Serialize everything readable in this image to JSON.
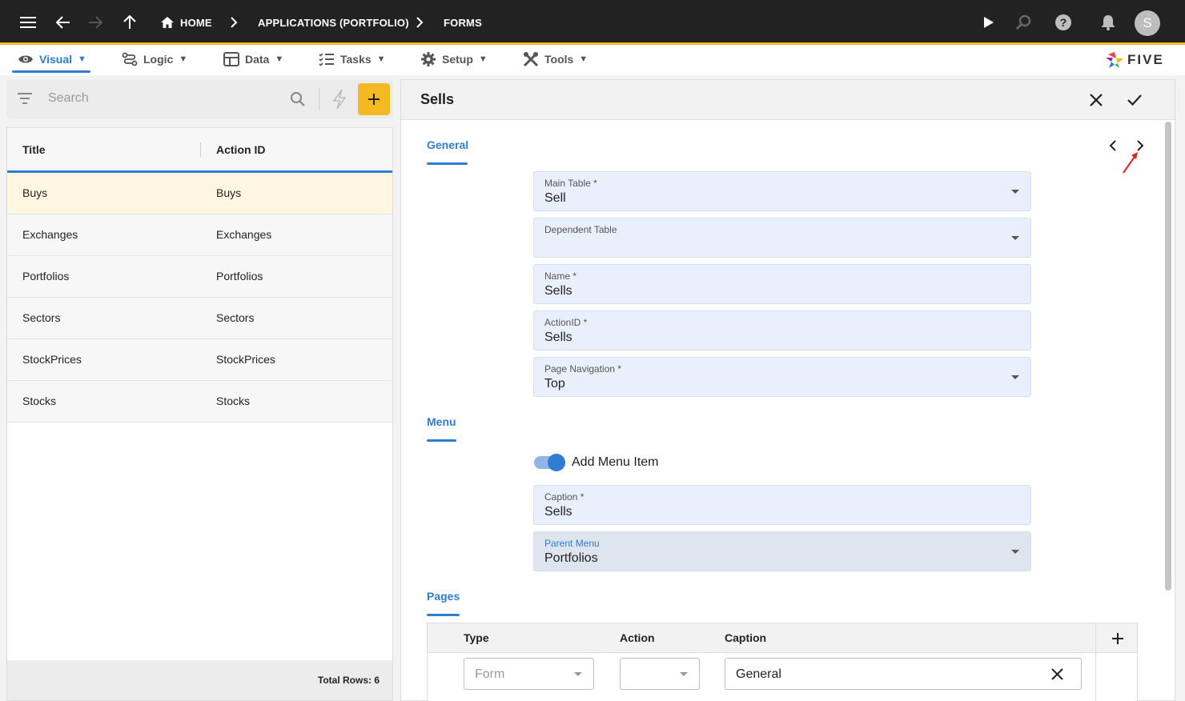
{
  "topbar": {
    "crumbs": [
      "HOME",
      "APPLICATIONS (PORTFOLIO)",
      "FORMS"
    ],
    "avatar_letter": "S",
    "accent": "#f5b921"
  },
  "menubar": {
    "items": [
      {
        "label": "Visual",
        "icon": "eye-icon"
      },
      {
        "label": "Logic",
        "icon": "flow-icon"
      },
      {
        "label": "Data",
        "icon": "table-icon"
      },
      {
        "label": "Tasks",
        "icon": "checklist-icon"
      },
      {
        "label": "Setup",
        "icon": "gear-icon"
      },
      {
        "label": "Tools",
        "icon": "tools-icon"
      }
    ],
    "active": "Visual",
    "logo_text": "FIVE"
  },
  "left": {
    "search_placeholder": "Search",
    "columns": [
      "Title",
      "Action ID"
    ],
    "rows": [
      {
        "title": "Buys",
        "action_id": "Buys"
      },
      {
        "title": "Exchanges",
        "action_id": "Exchanges"
      },
      {
        "title": "Portfolios",
        "action_id": "Portfolios"
      },
      {
        "title": "Sectors",
        "action_id": "Sectors"
      },
      {
        "title": "StockPrices",
        "action_id": "StockPrices"
      },
      {
        "title": "Stocks",
        "action_id": "Stocks"
      }
    ],
    "selected_row": "Buys",
    "total_rows": "Total Rows: 6"
  },
  "form": {
    "title": "Sells",
    "general": {
      "section_label": "General",
      "main_table": {
        "label": "Main Table *",
        "value": "Sell"
      },
      "dependent_table": {
        "label": "Dependent Table",
        "value": ""
      },
      "name": {
        "label": "Name *",
        "value": "Sells"
      },
      "action_id": {
        "label": "ActionID *",
        "value": "Sells"
      },
      "page_navigation": {
        "label": "Page Navigation *",
        "value": "Top"
      }
    },
    "menu": {
      "section_label": "Menu",
      "add_menu_item": {
        "label": "Add Menu Item",
        "on": true
      },
      "caption": {
        "label": "Caption *",
        "value": "Sells"
      },
      "parent_menu": {
        "label": "Parent Menu",
        "value": "Portfolios"
      }
    },
    "pages": {
      "section_label": "Pages",
      "columns": [
        "Type",
        "Action",
        "Caption"
      ],
      "rows": [
        {
          "type": "Form",
          "action": "",
          "caption": "General"
        }
      ]
    }
  }
}
